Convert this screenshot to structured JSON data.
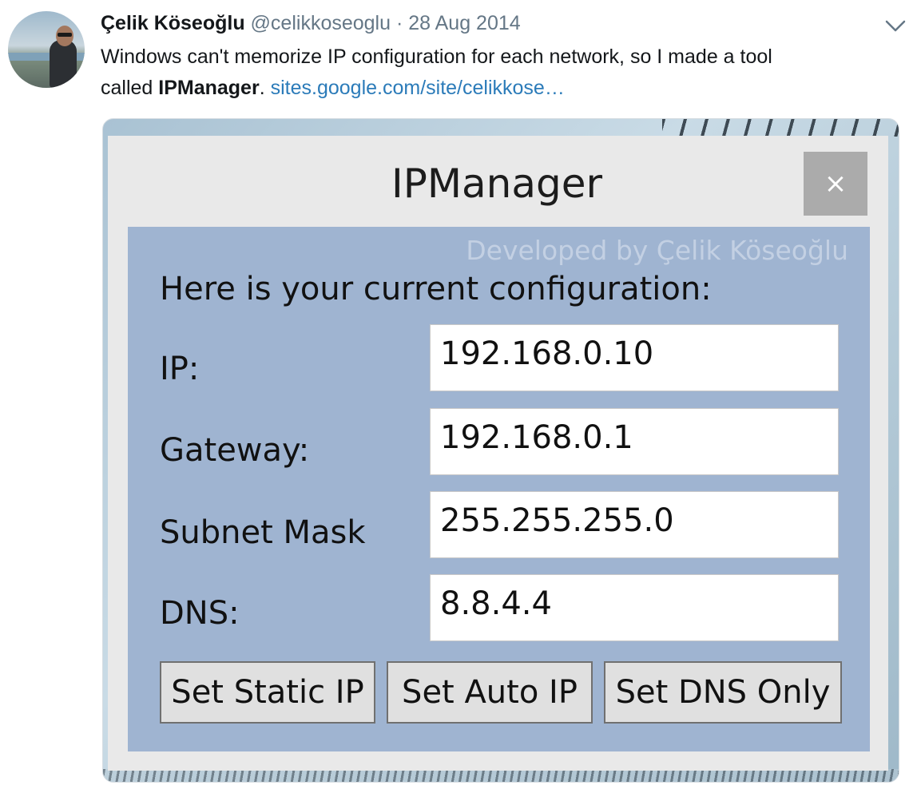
{
  "tweet": {
    "author_name": "Çelik Köseoğlu",
    "handle": "@celikkoseoglu",
    "separator": "·",
    "date": "28 Aug 2014",
    "text_line1": "Windows can't memorize IP configuration for each network, so I made a tool",
    "text_line2_prefix": "called ",
    "text_bold": "IPManager",
    "text_after_bold": ". ",
    "link_text": "sites.google.com/site/celikkose…"
  },
  "app": {
    "title": "IPManager",
    "close_label": "×",
    "watermark": "Developed by Çelik Köseoğlu",
    "heading": "Here is your current configuration:",
    "fields": {
      "ip": {
        "label": "IP:",
        "value": "192.168.0.10"
      },
      "gateway": {
        "label": "Gateway:",
        "value": "192.168.0.1"
      },
      "subnet": {
        "label": "Subnet Mask",
        "value": "255.255.255.0"
      },
      "dns": {
        "label": "DNS:",
        "value": "8.8.4.4"
      }
    },
    "buttons": {
      "static": "Set Static IP",
      "auto": "Set Auto IP",
      "dns_only": "Set DNS Only"
    }
  },
  "colors": {
    "link": "#2b7bb9",
    "panel": "#9fb4d1",
    "close_button": "#ababab",
    "watermark": "#c3d0e3"
  },
  "icons": {
    "caret": "chevron-down-icon",
    "close": "close-icon"
  }
}
